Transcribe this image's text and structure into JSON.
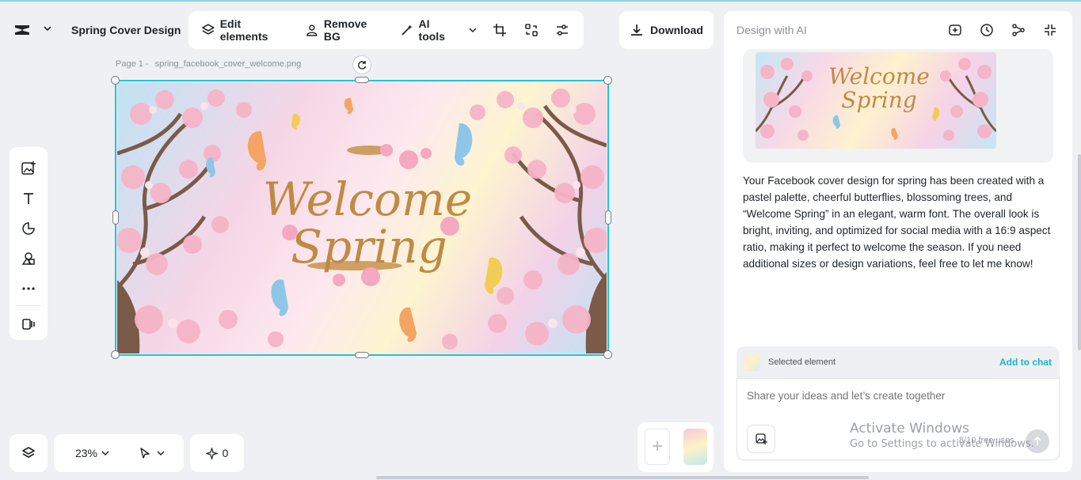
{
  "project": {
    "title": "Spring Cover Design"
  },
  "toolbar": {
    "edit_elements": "Edit elements",
    "remove_bg": "Remove BG",
    "ai_tools": "AI tools",
    "download": "Download"
  },
  "canvas": {
    "page_label": "Page 1 -",
    "filename": "spring_facebook_cover_welcome.png",
    "headline_line1": "Welcome",
    "headline_line2": "Spring"
  },
  "zoom": {
    "value": "23%"
  },
  "history": {
    "count": "0"
  },
  "panel": {
    "title": "Design with AI",
    "preview_line1": "Welcome",
    "preview_line2": "Spring",
    "message": "Your Facebook cover design for spring has been created with a pastel palette, cheerful butterflies, blossoming trees, and “Welcome Spring” in an elegant, warm font. The overall look is bright, inviting, and optimized for social media with a 16:9 aspect ratio, making it perfect to welcome the season. If you need additional sizes or design variations, feel free to let me know!",
    "selected_label": "Selected element",
    "add_to_chat": "Add to chat",
    "placeholder": "Share your ideas and let’s create together",
    "usage": "8/10 free uses"
  },
  "watermark": {
    "line1": "Activate Windows",
    "line2": "Go to Settings to activate Windows."
  },
  "colors": {
    "accent": "#19b5ca",
    "selection": "#22c3d8",
    "gold": "#c8924a",
    "petal": "#f4a9c0"
  }
}
